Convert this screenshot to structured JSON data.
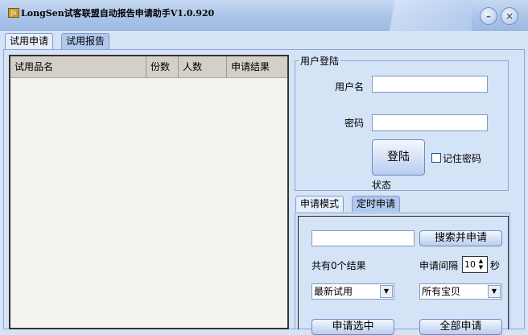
{
  "window": {
    "title": "LongSen试客联盟自动报告申请助手V1.0.920",
    "minimize": "–",
    "close": "×"
  },
  "tabs": [
    "试用申请",
    "试用报告"
  ],
  "table": {
    "columns": [
      "试用品名",
      "份数",
      "人数",
      "申请结果"
    ]
  },
  "login": {
    "legend": "用户登陆",
    "username_label": "用户名",
    "password_label": "密码",
    "username": "",
    "password": "",
    "login_button": "登陆",
    "remember": "记住密码",
    "status": "状态"
  },
  "mode_tabs": [
    "申请模式",
    "定时申请"
  ],
  "apply": {
    "search_value": "",
    "search_button": "搜索并申请",
    "result_count": "共有0个结果",
    "interval_label": "申请间隔",
    "interval_value": "10",
    "interval_unit": "秒",
    "sort_select": "最新试用",
    "category_select": "所有宝贝",
    "apply_selected": "申请选中",
    "apply_all": "全部申请"
  }
}
